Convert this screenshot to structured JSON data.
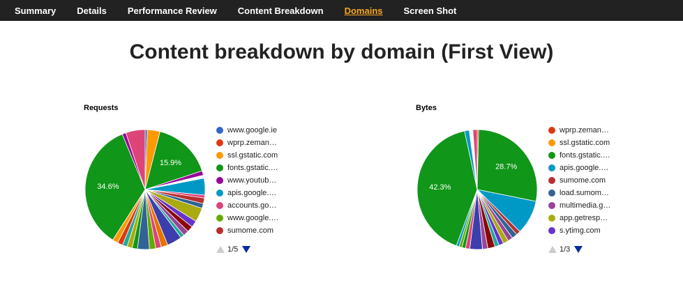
{
  "nav": {
    "items": [
      {
        "label": "Summary"
      },
      {
        "label": "Details"
      },
      {
        "label": "Performance Review"
      },
      {
        "label": "Content Breakdown"
      },
      {
        "label": "Domains",
        "active": true
      },
      {
        "label": "Screen Shot"
      }
    ]
  },
  "page": {
    "title": "Content breakdown by domain (First View)"
  },
  "charts": {
    "requests": {
      "title": "Requests",
      "legend": [
        {
          "label": "www.google.ie",
          "color": "#3366cc"
        },
        {
          "label": "wprp.zeman…",
          "color": "#dc3912"
        },
        {
          "label": "ssl.gstatic.com",
          "color": "#ff9900"
        },
        {
          "label": "fonts.gstatic.…",
          "color": "#109618"
        },
        {
          "label": "www.youtub…",
          "color": "#990099"
        },
        {
          "label": "apis.google.…",
          "color": "#0099c6"
        },
        {
          "label": "accounts.go…",
          "color": "#dd4477"
        },
        {
          "label": "www.google.…",
          "color": "#66aa00"
        },
        {
          "label": "sumome.com",
          "color": "#b82e2e"
        }
      ],
      "pager": "1/5"
    },
    "bytes": {
      "title": "Bytes",
      "legend": [
        {
          "label": "wprp.zeman…",
          "color": "#dc3912"
        },
        {
          "label": "ssl.gstatic.com",
          "color": "#ff9900"
        },
        {
          "label": "fonts.gstatic.…",
          "color": "#109618"
        },
        {
          "label": "apis.google.…",
          "color": "#0099c6"
        },
        {
          "label": "sumome.com",
          "color": "#b82e2e"
        },
        {
          "label": "load.sumom…",
          "color": "#316395"
        },
        {
          "label": "multimedia.g…",
          "color": "#994499"
        },
        {
          "label": "app.getresp…",
          "color": "#aaaa11"
        },
        {
          "label": "s.ytimg.com",
          "color": "#6633cc"
        }
      ],
      "pager": "1/3"
    }
  },
  "chart_data": [
    {
      "type": "pie",
      "title": "Requests",
      "slices": [
        {
          "value": 0.6,
          "color": "#3366cc"
        },
        {
          "value": 3.4,
          "color": "#ff9900"
        },
        {
          "value": 15.9,
          "color": "#109618",
          "label": "15.9%"
        },
        {
          "value": 1.2,
          "color": "#990099"
        },
        {
          "value": 0.8,
          "color": "#ffffff"
        },
        {
          "value": 4.5,
          "color": "#0099c6"
        },
        {
          "value": 0.8,
          "color": "#dd4477"
        },
        {
          "value": 1.5,
          "color": "#b82e2e"
        },
        {
          "value": 1.3,
          "color": "#316395"
        },
        {
          "value": 3.8,
          "color": "#aaaa11"
        },
        {
          "value": 1.8,
          "color": "#6633cc"
        },
        {
          "value": 1.6,
          "color": "#8b0707"
        },
        {
          "value": 1.5,
          "color": "#994499"
        },
        {
          "value": 1.0,
          "color": "#22aa99"
        },
        {
          "value": 4.0,
          "color": "#3b3eac"
        },
        {
          "value": 1.8,
          "color": "#e67300"
        },
        {
          "value": 1.5,
          "color": "#dd4477"
        },
        {
          "value": 1.7,
          "color": "#66aa00"
        },
        {
          "value": 3.2,
          "color": "#316395"
        },
        {
          "value": 1.4,
          "color": "#109618"
        },
        {
          "value": 1.4,
          "color": "#aaaa11"
        },
        {
          "value": 1.3,
          "color": "#22aa99"
        },
        {
          "value": 1.4,
          "color": "#dc3912"
        },
        {
          "value": 1.5,
          "color": "#ff9900"
        },
        {
          "value": 34.6,
          "color": "#109618",
          "label": "34.6%"
        },
        {
          "value": 1.0,
          "color": "#990099"
        },
        {
          "value": 5.2,
          "color": "#dd4477"
        }
      ]
    },
    {
      "type": "pie",
      "title": "Bytes",
      "slices": [
        {
          "value": 0.4,
          "color": "#dc3912"
        },
        {
          "value": 28.7,
          "color": "#109618",
          "label": "28.7%"
        },
        {
          "value": 9.5,
          "color": "#0099c6"
        },
        {
          "value": 1.2,
          "color": "#b82e2e"
        },
        {
          "value": 1.5,
          "color": "#316395"
        },
        {
          "value": 1.4,
          "color": "#994499"
        },
        {
          "value": 1.5,
          "color": "#aaaa11"
        },
        {
          "value": 1.3,
          "color": "#6633cc"
        },
        {
          "value": 1.2,
          "color": "#22aa99"
        },
        {
          "value": 2.0,
          "color": "#8b0707"
        },
        {
          "value": 1.5,
          "color": "#994499"
        },
        {
          "value": 3.5,
          "color": "#3b3eac"
        },
        {
          "value": 1.2,
          "color": "#dd4477"
        },
        {
          "value": 1.0,
          "color": "#109618"
        },
        {
          "value": 0.8,
          "color": "#66aa00"
        },
        {
          "value": 0.8,
          "color": "#0099c6"
        },
        {
          "value": 42.3,
          "color": "#109618",
          "label": "42.3%"
        },
        {
          "value": 1.3,
          "color": "#0099c6"
        },
        {
          "value": 1.0,
          "color": "#ffffff"
        },
        {
          "value": 1.2,
          "color": "#dd4477"
        }
      ]
    }
  ]
}
